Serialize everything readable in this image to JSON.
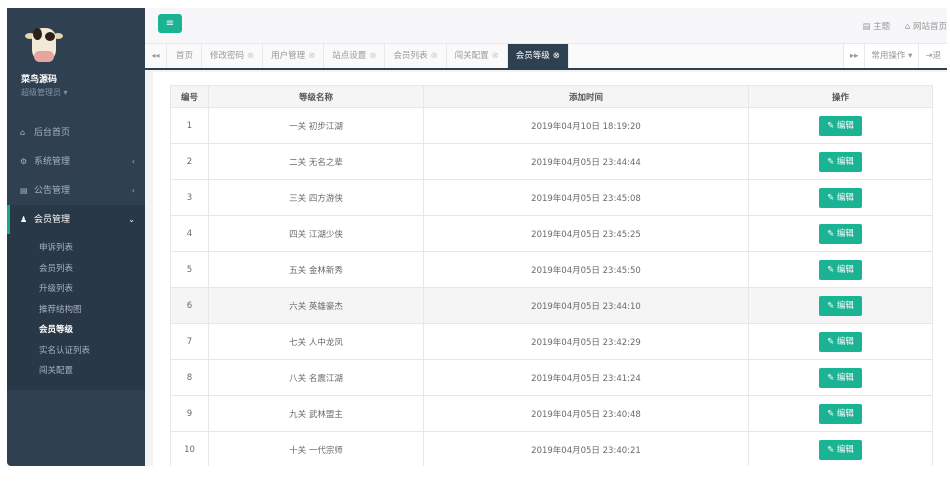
{
  "profile": {
    "name": "菜鸟源码",
    "role": "超级管理员 ▾"
  },
  "sidebar": {
    "items": [
      {
        "icon": "⌂",
        "label": "后台首页",
        "arrow": ""
      },
      {
        "icon": "⚙",
        "label": "系统管理",
        "arrow": "‹"
      },
      {
        "icon": "▤",
        "label": "公告管理",
        "arrow": "‹"
      },
      {
        "icon": "♟",
        "label": "会员管理",
        "arrow": "⌄"
      }
    ],
    "sub_items": [
      "申诉列表",
      "会员列表",
      "升级列表",
      "推荐结构图",
      "会员等级",
      "实名认证列表",
      "闯关配置"
    ]
  },
  "topbar": {
    "menu_icon": "≡",
    "theme": "▤ 主题",
    "home": "⌂ 网站首页"
  },
  "tabs": {
    "prev": "◂◂",
    "items": [
      {
        "label": "首页",
        "close": ""
      },
      {
        "label": "修改密码",
        "close": "⊗"
      },
      {
        "label": "用户管理",
        "close": "⊗"
      },
      {
        "label": "站点设置",
        "close": "⊗"
      },
      {
        "label": "会员列表",
        "close": "⊗"
      },
      {
        "label": "闯关配置",
        "close": "⊗"
      },
      {
        "label": "会员等级",
        "close": "⊗"
      }
    ],
    "next": "▸▸",
    "common_ops": "常用操作 ▾",
    "exit": "⇥退"
  },
  "table": {
    "headers": [
      "编号",
      "等级名称",
      "添加时间",
      "操作"
    ],
    "edit_label": "✎ 编辑",
    "rows": [
      {
        "id": "1",
        "name": "一关 初步江湖",
        "time": "2019年04月10日 18:19:20"
      },
      {
        "id": "2",
        "name": "二关 无名之辈",
        "time": "2019年04月05日 23:44:44"
      },
      {
        "id": "3",
        "name": "三关 四方游侠",
        "time": "2019年04月05日 23:45:08"
      },
      {
        "id": "4",
        "name": "四关 江湖少侠",
        "time": "2019年04月05日 23:45:25"
      },
      {
        "id": "5",
        "name": "五关 金林新秀",
        "time": "2019年04月05日 23:45:50"
      },
      {
        "id": "6",
        "name": "六关 英雄豪杰",
        "time": "2019年04月05日 23:44:10"
      },
      {
        "id": "7",
        "name": "七关 人中龙凤",
        "time": "2019年04月05日 23:42:29"
      },
      {
        "id": "8",
        "name": "八关 名震江湖",
        "time": "2019年04月05日 23:41:24"
      },
      {
        "id": "9",
        "name": "九关 武林盟主",
        "time": "2019年04月05日 23:40:48"
      },
      {
        "id": "10",
        "name": "十关 一代宗师",
        "time": "2019年04月05日 23:40:21"
      }
    ]
  },
  "colors": {
    "accent": "#1ab394",
    "sidebar": "#2f4050"
  }
}
